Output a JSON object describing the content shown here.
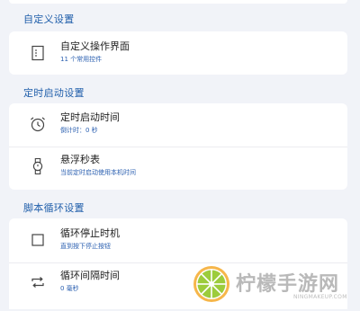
{
  "sections": {
    "custom": {
      "title": "自定义设置",
      "rows": [
        {
          "title": "自定义操作界面",
          "subtitle": "11 个常用控件",
          "icon": "list-icon"
        }
      ]
    },
    "timer": {
      "title": "定时启动设置",
      "rows": [
        {
          "title": "定时启动时间",
          "subtitle": "倒计时：0 秒",
          "icon": "alarm-clock-icon"
        },
        {
          "title": "悬浮秒表",
          "subtitle": "当前定时启动使用本机时间",
          "icon": "watch-icon"
        }
      ]
    },
    "loop": {
      "title": "脚本循环设置",
      "rows": [
        {
          "title": "循环停止时机",
          "subtitle": "直到按下停止按钮",
          "icon": "stop-square-icon"
        },
        {
          "title": "循环间隔时间",
          "subtitle": "0 毫秒",
          "icon": "repeat-icon"
        }
      ]
    }
  },
  "watermark": {
    "brand": "柠檬手游网",
    "domain": "NINGMAKEUP.COM"
  },
  "colors": {
    "background": "#f1f3f8",
    "section_title": "#1f5eaa",
    "subtitle": "#2a5fb0"
  }
}
